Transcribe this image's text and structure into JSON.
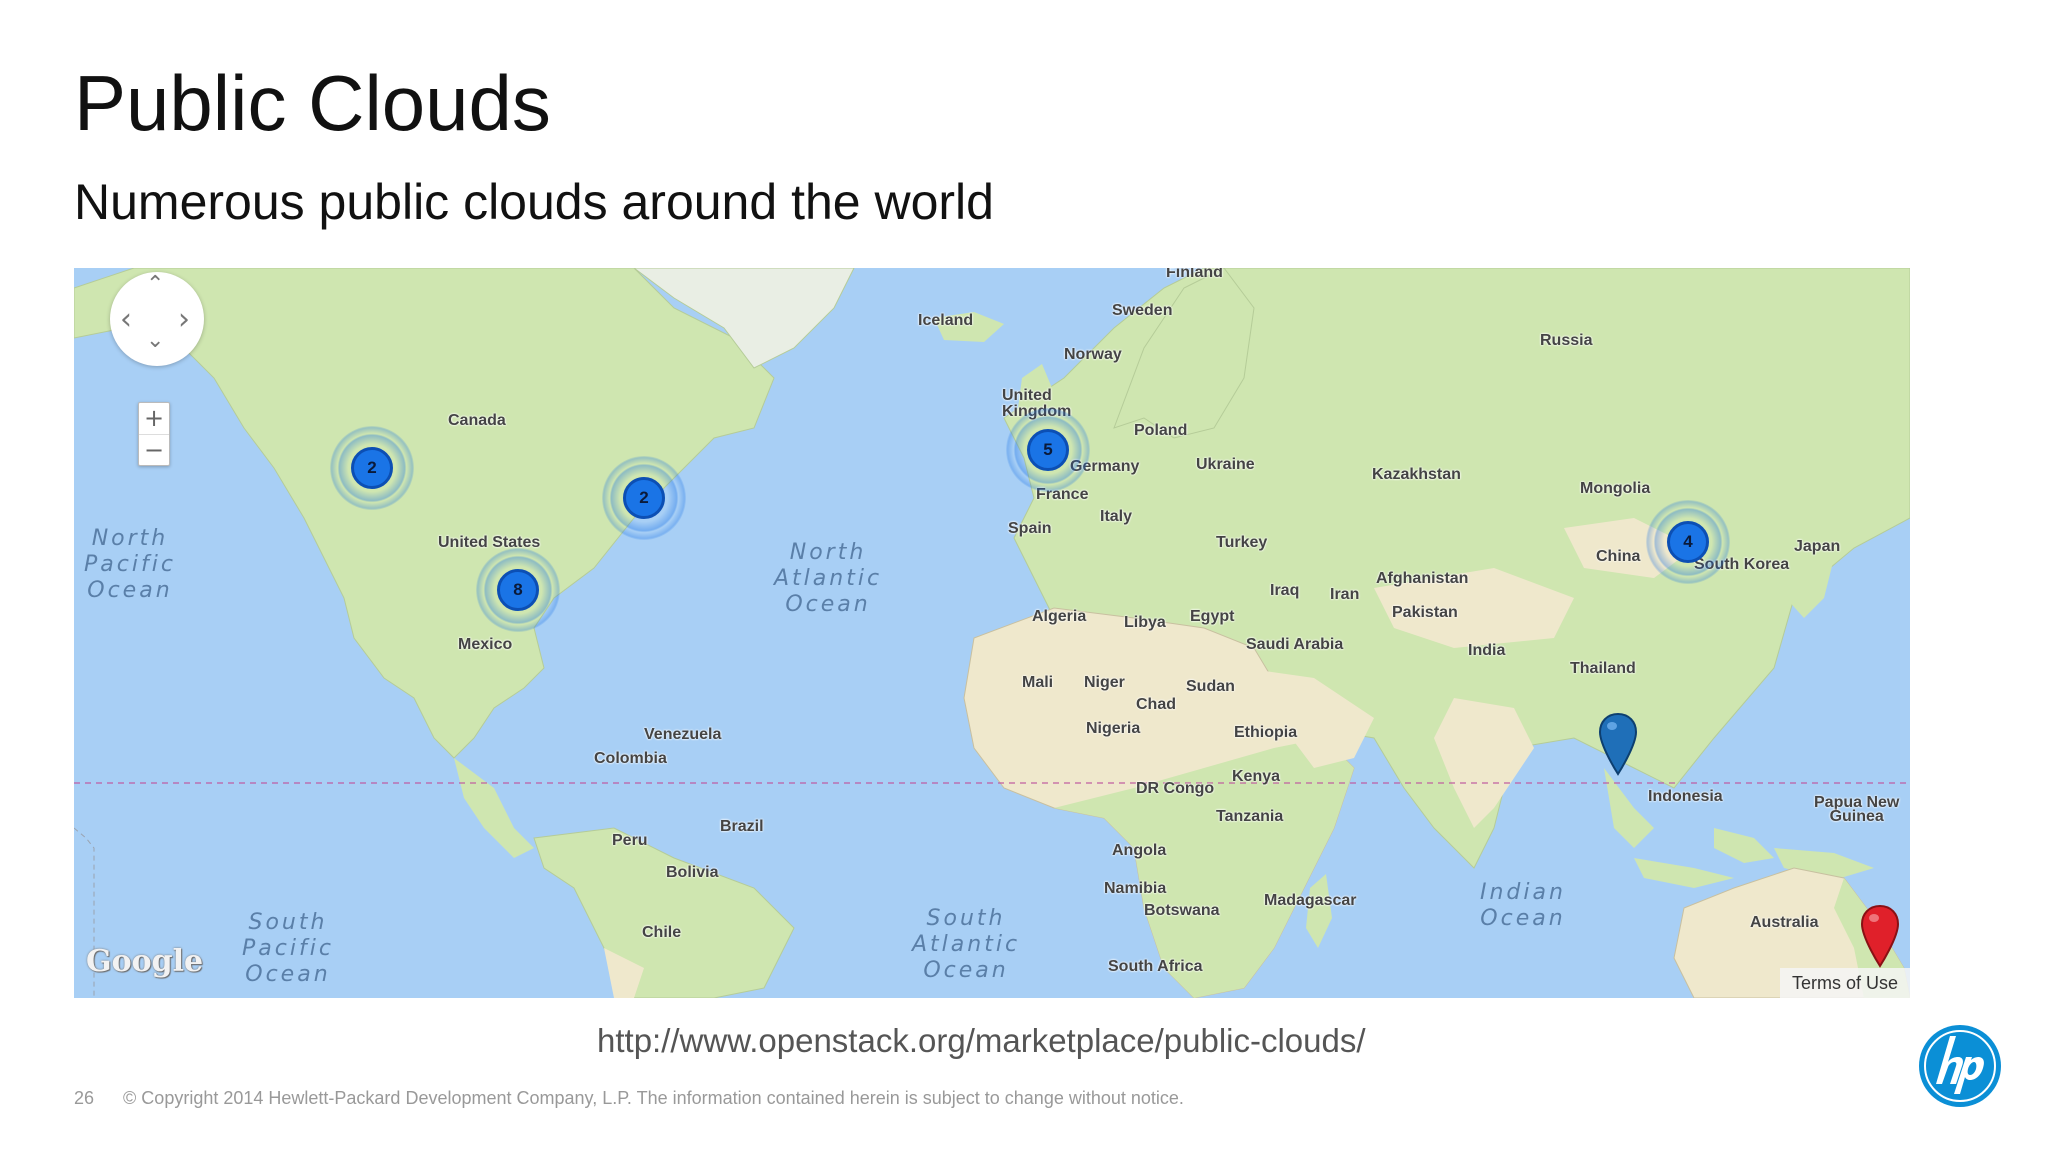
{
  "slide": {
    "title": "Public Clouds",
    "subtitle": "Numerous public clouds around the world",
    "url": "http://www.openstack.org/marketplace/public-clouds/",
    "page_number": "26",
    "copyright": "© Copyright 2014 Hewlett-Packard Development Company, L.P.  The information contained herein is subject to change without notice."
  },
  "map": {
    "zoom_in_label": "+",
    "zoom_out_label": "−",
    "pan_up": "⌃",
    "pan_down": "⌄",
    "pan_left": "‹",
    "pan_right": "›",
    "attribution": "Google",
    "terms_label": "Terms of Use",
    "land_color": "#cfe6b0",
    "water_color": "#a8cff5",
    "desert_color": "#efe8cc",
    "places": {
      "finland": "Finland",
      "sweden": "Sweden",
      "iceland": "Iceland",
      "norway": "Norway",
      "russia": "Russia",
      "united_kingdom": "United\nKingdom",
      "poland": "Poland",
      "canada": "Canada",
      "germany": "Germany",
      "ukraine": "Ukraine",
      "france": "France",
      "kazakhstan": "Kazakhstan",
      "mongolia": "Mongolia",
      "italy": "Italy",
      "spain": "Spain",
      "united_states": "United States",
      "turkey": "Turkey",
      "japan": "Japan",
      "china": "China",
      "south_korea": "South Korea",
      "afghanistan": "Afghanistan",
      "iraq": "Iraq",
      "iran": "Iran",
      "algeria": "Algeria",
      "libya": "Libya",
      "egypt": "Egypt",
      "pakistan": "Pakistan",
      "saudi_arabia": "Saudi Arabia",
      "mexico": "Mexico",
      "india": "India",
      "thailand": "Thailand",
      "mali": "Mali",
      "niger": "Niger",
      "sudan": "Sudan",
      "chad": "Chad",
      "nigeria": "Nigeria",
      "ethiopia": "Ethiopia",
      "venezuela": "Venezuela",
      "colombia": "Colombia",
      "kenya": "Kenya",
      "dr_congo": "DR Congo",
      "indonesia": "Indonesia",
      "papua_new_guinea": "Papua New\nGuinea",
      "tanzania": "Tanzania",
      "brazil": "Brazil",
      "peru": "Peru",
      "angola": "Angola",
      "bolivia": "Bolivia",
      "namibia": "Namibia",
      "madagascar": "Madagascar",
      "botswana": "Botswana",
      "australia": "Australia",
      "chile": "Chile",
      "south_africa": "South Africa"
    },
    "oceans": {
      "north_pacific": "North\nPacific\nOcean",
      "north_atlantic": "North\nAtlantic\nOcean",
      "south_pacific": "South\nPacific\nOcean",
      "south_atlantic": "South\nAtlantic\nOcean",
      "indian": "Indian\nOcean"
    },
    "clusters": [
      {
        "label": "2",
        "region": "west coast north america"
      },
      {
        "label": "2",
        "region": "eastern north america"
      },
      {
        "label": "8",
        "region": "southern united states"
      },
      {
        "label": "5",
        "region": "western europe"
      },
      {
        "label": "4",
        "region": "east asia"
      }
    ],
    "markers": [
      {
        "color": "#1f6fb8",
        "region": "singapore"
      },
      {
        "color": "#e0202a",
        "region": "eastern australia"
      }
    ]
  }
}
